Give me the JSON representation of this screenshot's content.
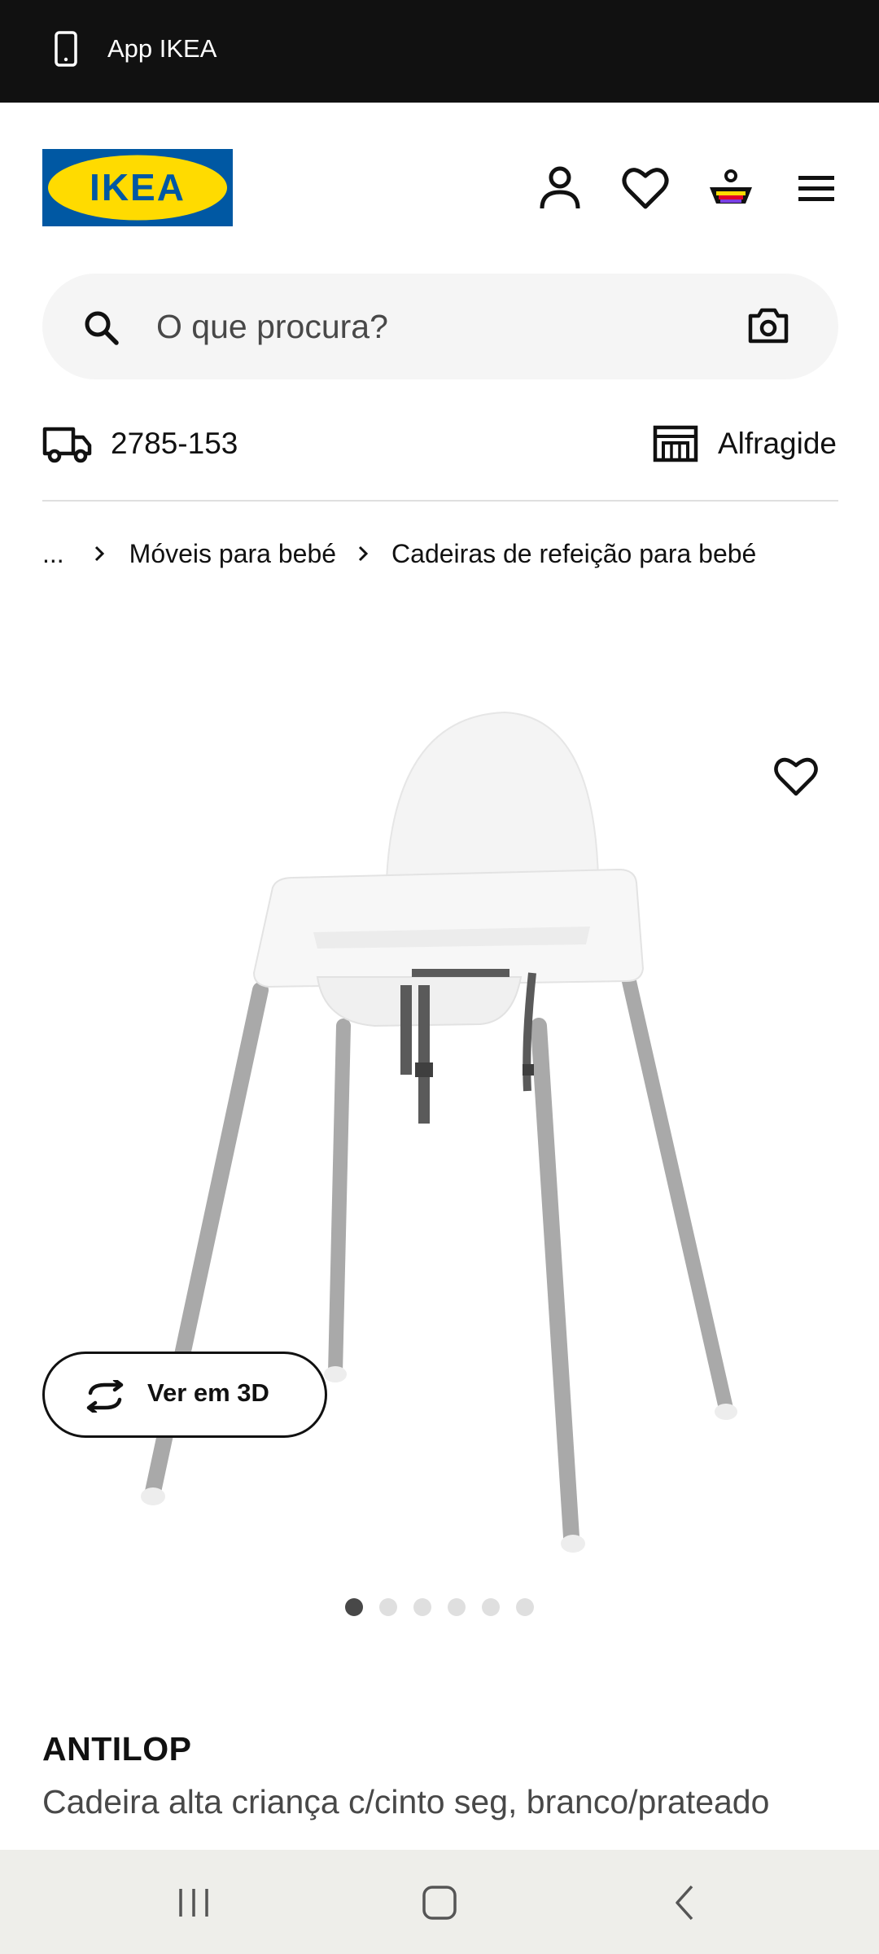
{
  "app_bar": {
    "title": "App IKEA",
    "icon": "smartphone-icon"
  },
  "brand": {
    "logo_text": "IKEA",
    "logo_blue": "#0058a3",
    "logo_yellow": "#ffdb00"
  },
  "header_icons": [
    "user-icon",
    "heart-icon",
    "shopping-basket-icon",
    "menu-icon"
  ],
  "search": {
    "placeholder": "O que procura?",
    "icons": [
      "search-icon",
      "camera-icon"
    ]
  },
  "location": {
    "postal_code": "2785-153",
    "store": "Alfragide"
  },
  "breadcrumb": {
    "ellipsis": "...",
    "items": [
      "Móveis para bebé",
      "Cadeiras de refeição para bebé"
    ]
  },
  "product": {
    "view_3d_label": "Ver em 3D",
    "image_count": 6,
    "active_image": 1,
    "name": "ANTILOP",
    "description": "Cadeira alta criança c/cinto seg, branco/prateado"
  },
  "system_nav": [
    "recent-apps-icon",
    "home-icon",
    "back-icon"
  ]
}
